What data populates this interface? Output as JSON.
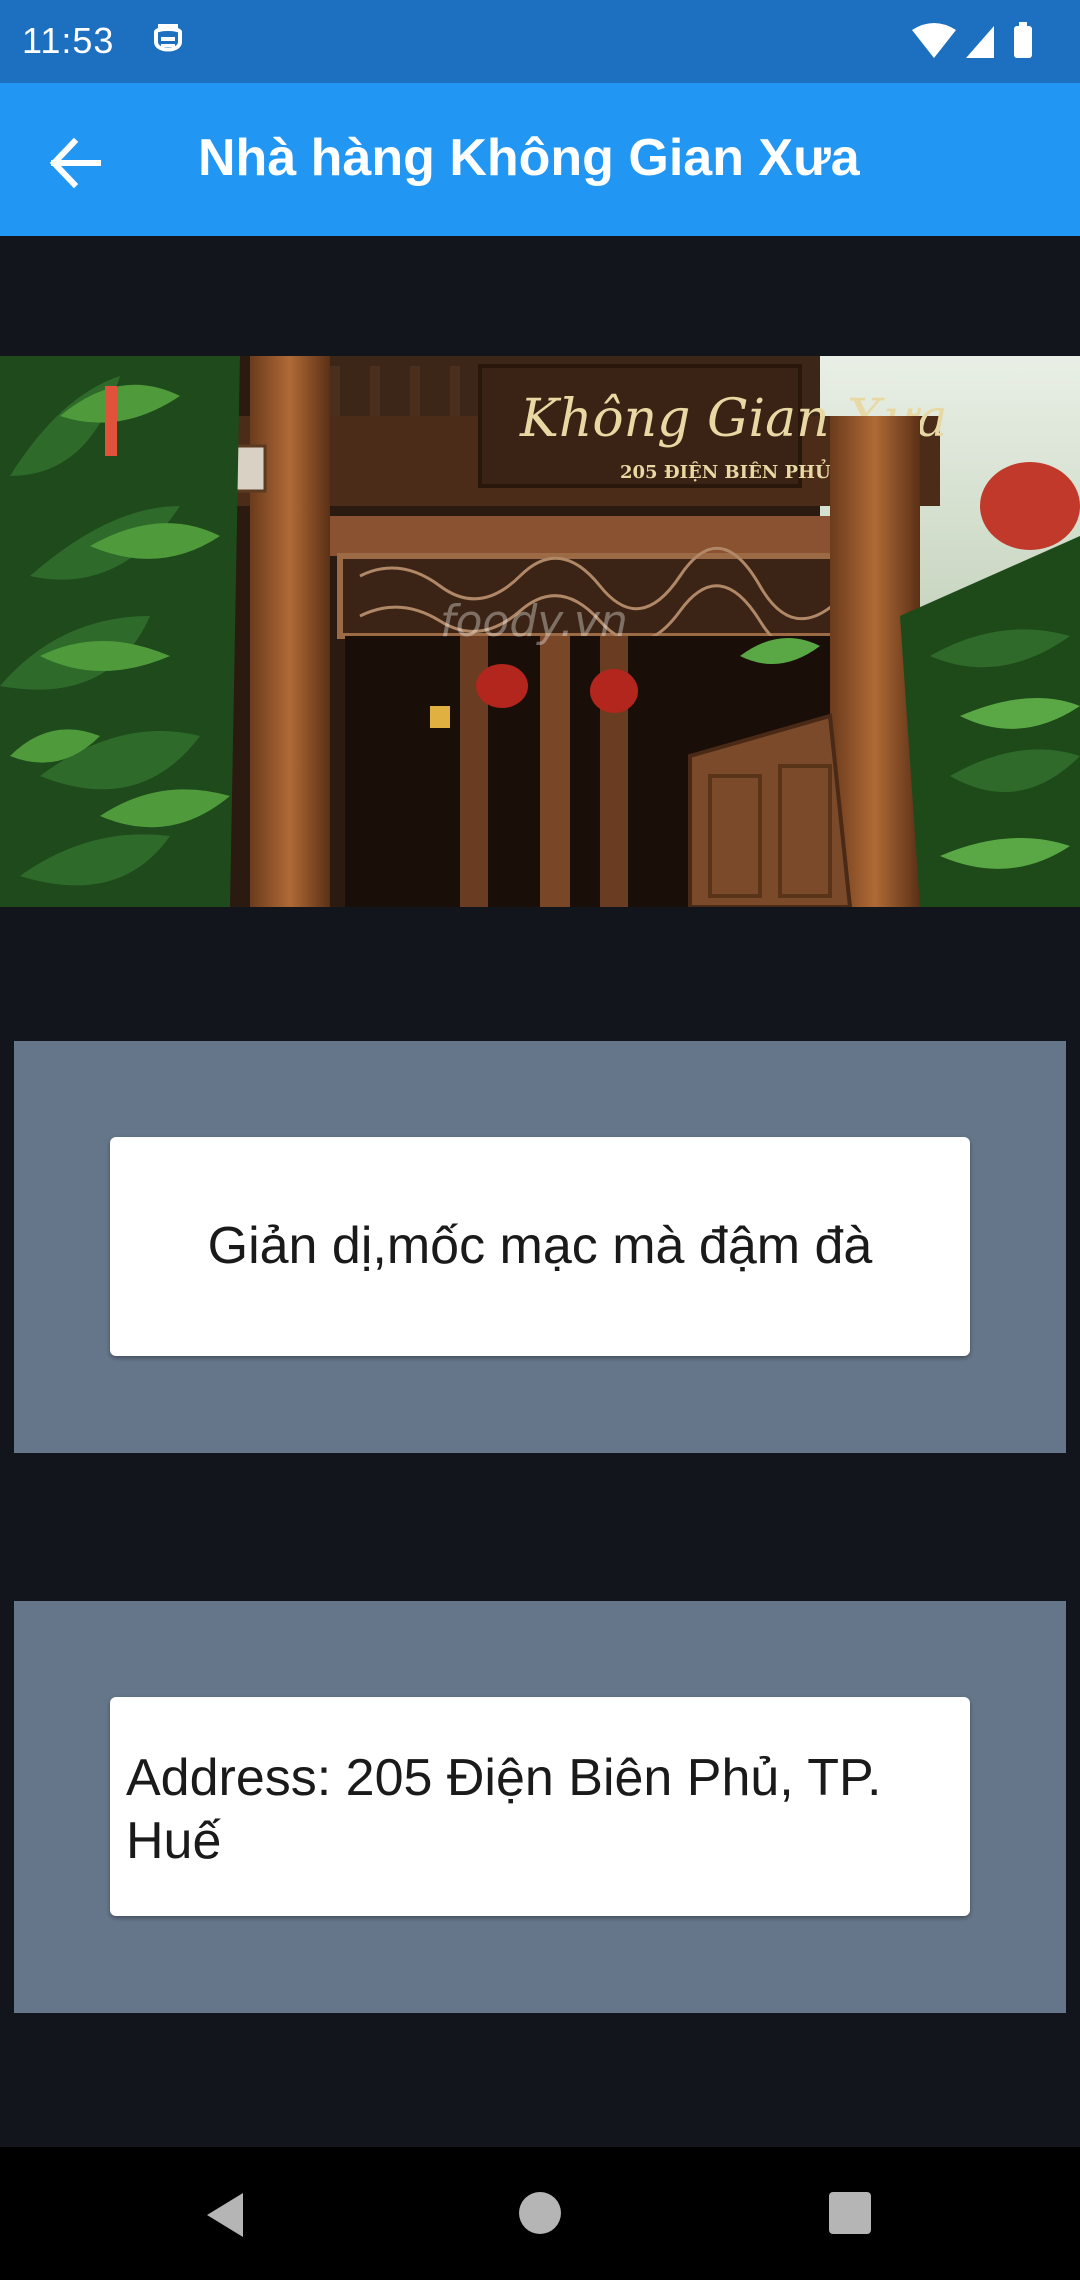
{
  "status_bar": {
    "time": "11:53",
    "icons": [
      "notification-icon",
      "wifi-icon",
      "cell-signal-icon",
      "battery-icon"
    ]
  },
  "app_bar": {
    "title": "Nhà hàng Không Gian Xưa",
    "back_icon": "arrow-back-icon",
    "color": "#2196f3"
  },
  "hero_image": {
    "sign_text": "Không Gian Xưa",
    "sign_address": "205 ĐIỆN BIÊN PHỦ",
    "watermark": "foody.vn"
  },
  "cards": {
    "tagline": "Giản dị,mốc mạc mà đậm đà",
    "address": "Address: 205 Điện Biên Phủ, TP. Huế"
  },
  "nav_bar": {
    "icons": [
      "nav-back-icon",
      "nav-home-icon",
      "nav-recents-icon"
    ]
  }
}
